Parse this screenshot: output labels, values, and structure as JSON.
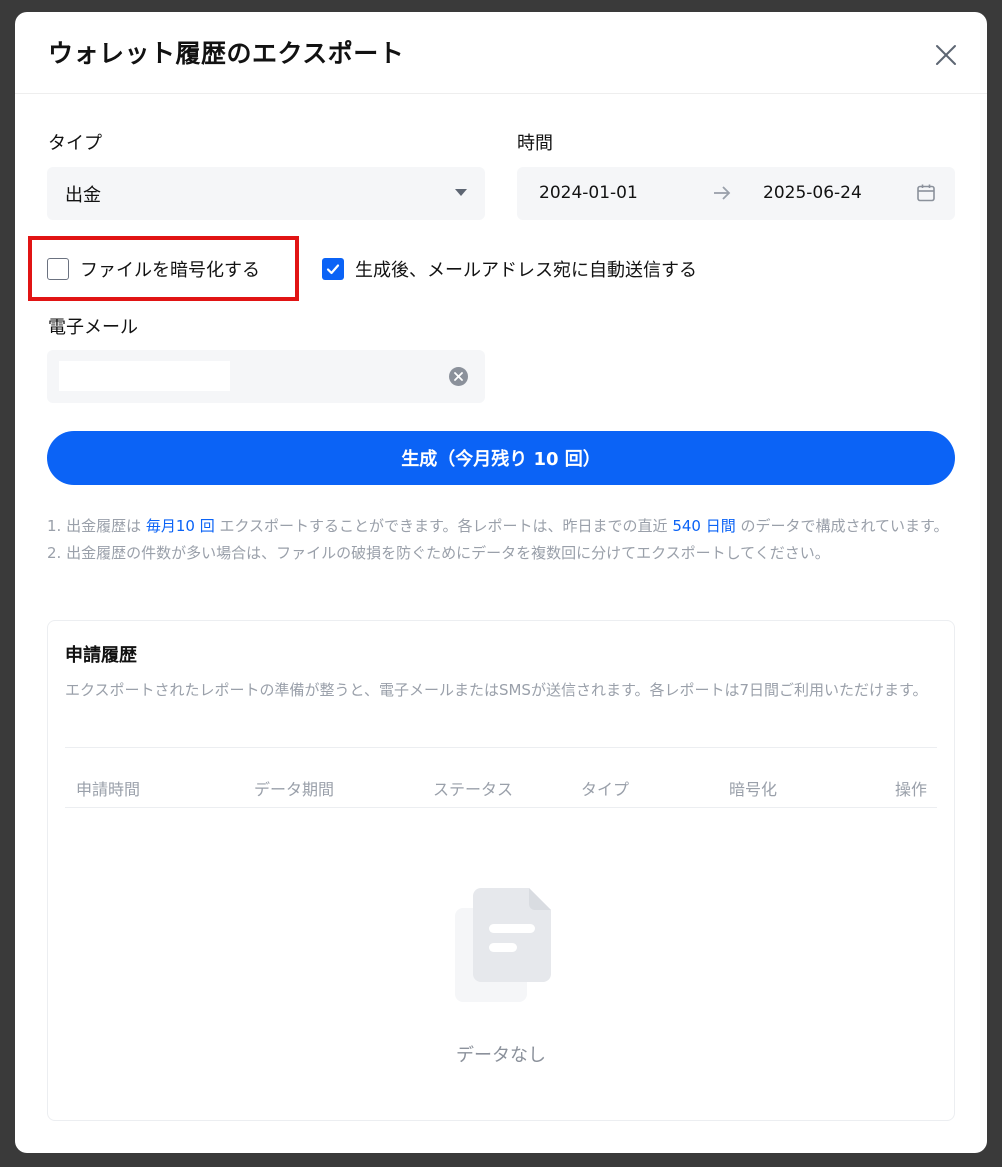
{
  "modal": {
    "title": "ウォレット履歴のエクスポート"
  },
  "form": {
    "type_label": "タイプ",
    "type_value": "出金",
    "time_label": "時間",
    "date_start": "2024-01-01",
    "date_end": "2025-06-24",
    "encrypt_label": "ファイルを暗号化する",
    "encrypt_checked": false,
    "autosend_label": "生成後、メールアドレス宛に自動送信する",
    "autosend_checked": true,
    "email_label": "電子メール",
    "email_value": ""
  },
  "generate": {
    "label": "生成（今月残り 10 回）"
  },
  "notes": {
    "line1_a": "1. 出金履歴は ",
    "line1_hl1": "毎月10 回",
    "line1_b": " エクスポートすることができます。各レポートは、昨日までの直近 ",
    "line1_hl2": "540 日間",
    "line1_c": " のデータで構成されています。",
    "line2": "2. 出金履歴の件数が多い場合は、ファイルの破損を防ぐためにデータを複数回に分けてエクスポートしてください。"
  },
  "history": {
    "title": "申請履歴",
    "description": "エクスポートされたレポートの準備が整うと、電子メールまたはSMSが送信されます。各レポートは7日間ご利用いただけます。",
    "columns": [
      "申請時間",
      "データ期間",
      "ステータス",
      "タイプ",
      "暗号化",
      "操作"
    ],
    "empty_text": "データなし"
  },
  "colors": {
    "accent": "#0b63f6",
    "highlight": "#e11414"
  }
}
